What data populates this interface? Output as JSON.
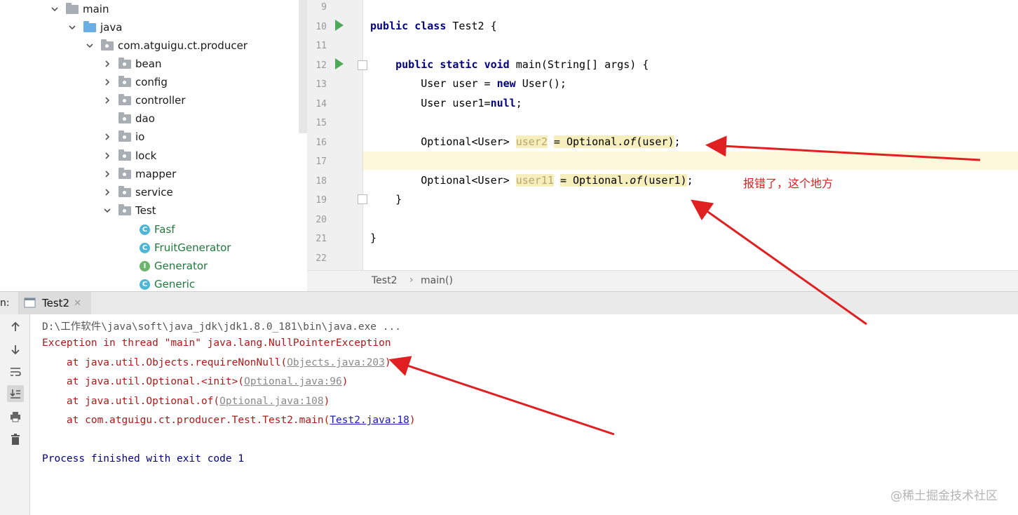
{
  "tree": {
    "main": "main",
    "java": "java",
    "package": "com.atguigu.ct.producer",
    "folders": [
      "bean",
      "config",
      "controller",
      "dao",
      "io",
      "lock",
      "mapper",
      "service",
      "Test"
    ],
    "classes": [
      {
        "badge": "C",
        "name": "Fasf"
      },
      {
        "badge": "C",
        "name": "FruitGenerator"
      },
      {
        "badge": "I",
        "name": "Generator"
      },
      {
        "badge": "C",
        "name": "Generic"
      }
    ]
  },
  "editor": {
    "line_numbers": [
      "9",
      "10",
      "11",
      "12",
      "13",
      "14",
      "15",
      "16",
      "17",
      "18",
      "19",
      "20",
      "21",
      "22"
    ],
    "code": {
      "kw_public": "public",
      "kw_class": "class",
      "class_decl_rest": "Test2 {",
      "kw_static": "static",
      "kw_void": "void",
      "main_sig": "main(String[] args) {",
      "user_decl": "User user = ",
      "kw_new": "new",
      "user_new_rest": "User();",
      "user1_decl": "User user1=",
      "kw_null": "null",
      "semicolon": ";",
      "optional_type": "Optional<User>",
      "var_user2": "user2",
      "var_user11": "user11",
      "assign_optional": "= Optional.",
      "method_of": "of",
      "arg_user": "(user)",
      "arg_user1": "(user1)",
      "close_method": "}",
      "close_class": "}"
    },
    "breadcrumb": {
      "class": "Test2",
      "separator": "›",
      "method": "main()"
    }
  },
  "run_panel": {
    "prefix": "n:",
    "tab_label": "Test2",
    "console": {
      "command": "D:\\工作软件\\java\\soft\\java_jdk\\jdk1.8.0_181\\bin\\java.exe ...",
      "exception": "Exception in thread \"main\" java.lang.NullPointerException",
      "frames": [
        {
          "prefix": "    at java.util.Objects.requireNonNull(",
          "link": "Objects.java:203",
          "suffix": ")"
        },
        {
          "prefix": "    at java.util.Optional.<init>(",
          "link": "Optional.java:96",
          "suffix": ")"
        },
        {
          "prefix": "    at java.util.Optional.of(",
          "link": "Optional.java:108",
          "suffix": ")"
        },
        {
          "prefix": "    at com.atguigu.ct.producer.Test.Test2.main(",
          "link": "Test2.java:18",
          "suffix": ")"
        }
      ],
      "finished": "Process finished with exit code 1"
    }
  },
  "annotation": "报错了，这个地方",
  "watermark": "@稀土掘金技术社区",
  "colors": {
    "arrow": "#e02020",
    "keyword": "#000080",
    "run_green": "#4caa5a",
    "error_red": "#b01818"
  }
}
